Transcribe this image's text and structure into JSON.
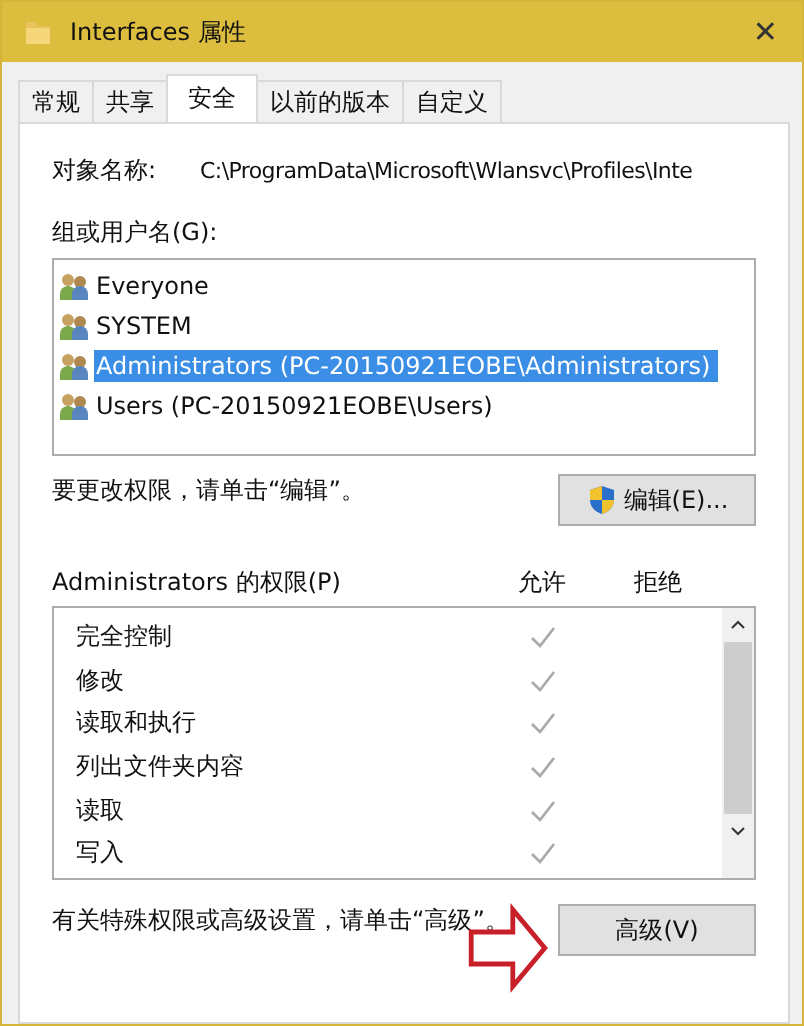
{
  "window": {
    "title": "Interfaces 属性",
    "close": "✕"
  },
  "tabs": [
    {
      "label": "常规",
      "selected": false
    },
    {
      "label": "共享",
      "selected": false
    },
    {
      "label": "安全",
      "selected": true
    },
    {
      "label": "以前的版本",
      "selected": false
    },
    {
      "label": "自定义",
      "selected": false
    }
  ],
  "object_name": {
    "label": "对象名称:",
    "value": "C:\\ProgramData\\Microsoft\\Wlansvc\\Profiles\\Inte"
  },
  "groups": {
    "label": "组或用户名(G):",
    "items": [
      {
        "name": "Everyone",
        "selected": false
      },
      {
        "name": "SYSTEM",
        "selected": false
      },
      {
        "name": "Administrators (PC-20150921EOBE\\Administrators)",
        "selected": true
      },
      {
        "name": "Users (PC-20150921EOBE\\Users)",
        "selected": false
      }
    ]
  },
  "edit_hint": "要更改权限，请单击“编辑”。",
  "edit_button": "编辑(E)...",
  "permissions": {
    "label": "Administrators 的权限(P)",
    "allow_header": "允许",
    "deny_header": "拒绝",
    "rows": [
      {
        "name": "完全控制",
        "allow": true,
        "deny": false
      },
      {
        "name": "修改",
        "allow": true,
        "deny": false
      },
      {
        "name": "读取和执行",
        "allow": true,
        "deny": false
      },
      {
        "name": "列出文件夹内容",
        "allow": true,
        "deny": false
      },
      {
        "name": "读取",
        "allow": true,
        "deny": false
      },
      {
        "name": "写入",
        "allow": true,
        "deny": false
      }
    ]
  },
  "advanced_hint": "有关特殊权限或高级设置，请单击“高级”。",
  "advanced_button": "高级(V)"
}
